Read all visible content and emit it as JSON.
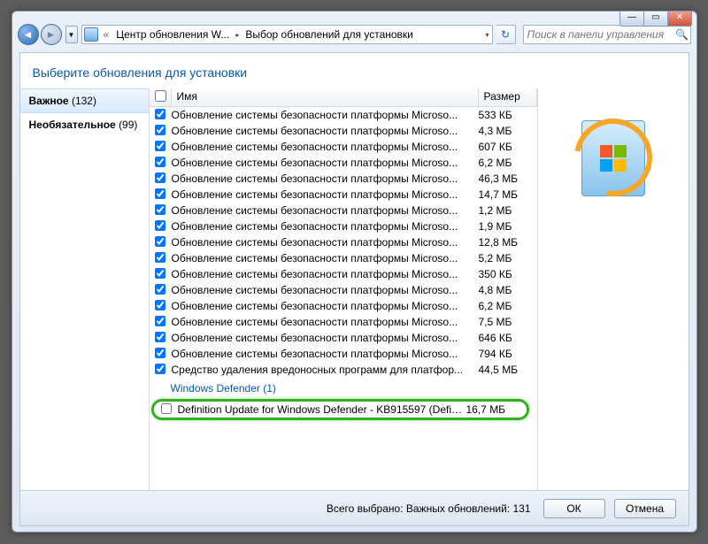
{
  "breadcrumb": {
    "root": "Центр обновления W...",
    "sep": "›",
    "current": "Выбор обновлений для установки"
  },
  "search": {
    "placeholder": "Поиск в панели управления"
  },
  "heading": "Выберите обновления для установки",
  "sidebar": {
    "items": [
      {
        "label": "Важное",
        "count": "(132)",
        "active": true
      },
      {
        "label": "Необязательное",
        "count": "(99)",
        "active": false
      }
    ]
  },
  "columns": {
    "name": "Имя",
    "size": "Размер"
  },
  "updates": [
    {
      "name": "Обновление системы безопасности платформы Microso...",
      "size": "533 КБ",
      "checked": true
    },
    {
      "name": "Обновление системы безопасности платформы Microso...",
      "size": "4,3 МБ",
      "checked": true
    },
    {
      "name": "Обновление системы безопасности платформы Microso...",
      "size": "607 КБ",
      "checked": true
    },
    {
      "name": "Обновление системы безопасности платформы Microso...",
      "size": "6,2 МБ",
      "checked": true
    },
    {
      "name": "Обновление системы безопасности платформы Microso...",
      "size": "46,3 МБ",
      "checked": true
    },
    {
      "name": "Обновление системы безопасности платформы Microso...",
      "size": "14,7 МБ",
      "checked": true
    },
    {
      "name": "Обновление системы безопасности платформы Microso...",
      "size": "1,2 МБ",
      "checked": true
    },
    {
      "name": "Обновление системы безопасности платформы Microso...",
      "size": "1,9 МБ",
      "checked": true
    },
    {
      "name": "Обновление системы безопасности платформы Microso...",
      "size": "12,8 МБ",
      "checked": true
    },
    {
      "name": "Обновление системы безопасности платформы Microso...",
      "size": "5,2 МБ",
      "checked": true
    },
    {
      "name": "Обновление системы безопасности платформы Microso...",
      "size": "350 КБ",
      "checked": true
    },
    {
      "name": "Обновление системы безопасности платформы Microso...",
      "size": "4,8 МБ",
      "checked": true
    },
    {
      "name": "Обновление системы безопасности платформы Microso...",
      "size": "6,2 МБ",
      "checked": true
    },
    {
      "name": "Обновление системы безопасности платформы Microso...",
      "size": "7,5 МБ",
      "checked": true
    },
    {
      "name": "Обновление системы безопасности платформы Microso...",
      "size": "646 КБ",
      "checked": true
    },
    {
      "name": "Обновление системы безопасности платформы Microso...",
      "size": "794 КБ",
      "checked": true
    },
    {
      "name": "Средство удаления вредоносных программ для платфор...",
      "size": "44,5 МБ",
      "checked": true
    }
  ],
  "group2": {
    "title": "Windows Defender (1)"
  },
  "defender": {
    "name": "Definition Update for Windows Defender - KB915597 (Defini...",
    "size": "16,7 МБ",
    "checked": false
  },
  "footer": {
    "status": "Всего выбрано: Важных обновлений: 131",
    "ok": "ОК",
    "cancel": "Отмена"
  },
  "winbtns": {
    "min": "—",
    "max": "▭",
    "close": "✕"
  }
}
